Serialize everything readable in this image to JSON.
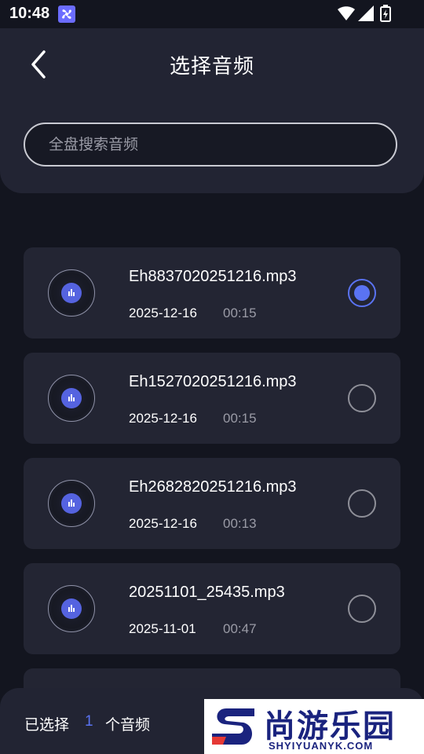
{
  "status_bar": {
    "time": "10:48",
    "icons": [
      "fan-icon",
      "wifi-icon",
      "signal-icon",
      "battery-icon"
    ]
  },
  "header": {
    "back_icon": "chevron-left-icon",
    "title": "选择音频",
    "search": {
      "placeholder": "全盘搜索音频",
      "value": ""
    }
  },
  "audio_items": [
    {
      "name": "Eh8837020251216.mp3",
      "date": "2025-12-16",
      "duration": "00:15",
      "selected": true
    },
    {
      "name": "Eh1527020251216.mp3",
      "date": "2025-12-16",
      "duration": "00:15",
      "selected": false
    },
    {
      "name": "Eh2682820251216.mp3",
      "date": "2025-12-16",
      "duration": "00:13",
      "selected": false
    },
    {
      "name": "20251101_25435.mp3",
      "date": "2025-11-01",
      "duration": "00:47",
      "selected": false
    }
  ],
  "bottom_bar": {
    "prefix": "已选择",
    "count": "1",
    "suffix": "个音频"
  },
  "watermark": {
    "text": "尚游乐园",
    "url": "SHYIYUANYK.COM"
  },
  "colors": {
    "background": "#13151f",
    "panel": "#222433",
    "item": "#232533",
    "accent": "#5a73f2"
  }
}
